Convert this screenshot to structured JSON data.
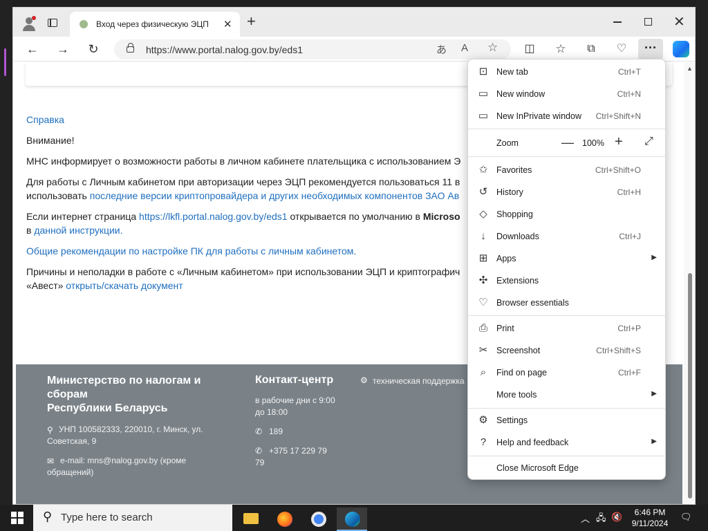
{
  "tab": {
    "title": "Вход через физическую ЭЦП"
  },
  "address": {
    "url": "https://www.portal.nalog.gov.by/eds1"
  },
  "page": {
    "help_link": "Справка",
    "attention": "Внимание!",
    "p1": "МНС информирует о возможности работы в личном кабинете плательщика с использованием Э",
    "p2a": "Для работы с Личным кабинетом при авторизации через ЭЦП рекомендуется пользоваться 11 в",
    "p2b_prefix": "использовать ",
    "p2b_link": "последние версии криптопровайдера и других необходимых компонентов ЗАО Ав",
    "p3_prefix": "Если интернет страница ",
    "p3_link": "https://lkfl.portal.nalog.gov.by/eds1",
    "p3_mid": " открывается по умолчанию в ",
    "p3_bold": "Microso",
    "p3b_prefix": "в ",
    "p3b_link": "данной инструкции",
    "p3b_suffix": ".",
    "p4_link": "Общие рекомендации по настройке ПК для работы с личным кабинетом.",
    "p5": "Причины и неполадки в работе с «Личным кабинетом» при использовании ЭЦП и криптографич",
    "p5b_prefix": "«Авест» ",
    "p5b_link": "открыть/скачать документ"
  },
  "footer": {
    "org_line1": "Министерство по налогам и",
    "org_line2": "сборам",
    "org_line3": "Республики Беларусь",
    "address_line1": "УНП 100582333, 220010, г. Минск, ул.",
    "address_line2": "Советская, 9",
    "email_line1": "e-mail: mns@nalog.gov.by (кроме",
    "email_line2": "обращений)",
    "contact_title": "Контакт-центр",
    "hours_line1": "в рабочие дни с 9:00",
    "hours_line2": "до 18:00",
    "phone_short": "189",
    "phone_long_line1": "+375 17 229 79",
    "phone_long_line2": "79",
    "support": "техническая поддержка"
  },
  "menu": {
    "new_tab": {
      "label": "New tab",
      "shortcut": "Ctrl+T"
    },
    "new_window": {
      "label": "New window",
      "shortcut": "Ctrl+N"
    },
    "inprivate": {
      "label": "New InPrivate window",
      "shortcut": "Ctrl+Shift+N"
    },
    "zoom": {
      "label": "Zoom",
      "value": "100%"
    },
    "favorites": {
      "label": "Favorites",
      "shortcut": "Ctrl+Shift+O"
    },
    "history": {
      "label": "History",
      "shortcut": "Ctrl+H"
    },
    "shopping": {
      "label": "Shopping"
    },
    "downloads": {
      "label": "Downloads",
      "shortcut": "Ctrl+J"
    },
    "apps": {
      "label": "Apps"
    },
    "extensions": {
      "label": "Extensions"
    },
    "essentials": {
      "label": "Browser essentials"
    },
    "print": {
      "label": "Print",
      "shortcut": "Ctrl+P"
    },
    "screenshot": {
      "label": "Screenshot",
      "shortcut": "Ctrl+Shift+S"
    },
    "find": {
      "label": "Find on page",
      "shortcut": "Ctrl+F"
    },
    "more_tools": {
      "label": "More tools"
    },
    "settings": {
      "label": "Settings"
    },
    "help": {
      "label": "Help and feedback"
    },
    "close": {
      "label": "Close Microsoft Edge"
    }
  },
  "taskbar": {
    "search_placeholder": "Type here to search",
    "time": "6:46 PM",
    "date": "9/11/2024"
  },
  "colors": {
    "link": "#1f6fbf",
    "footer": "#7a8288",
    "accent": "#d0232a"
  }
}
